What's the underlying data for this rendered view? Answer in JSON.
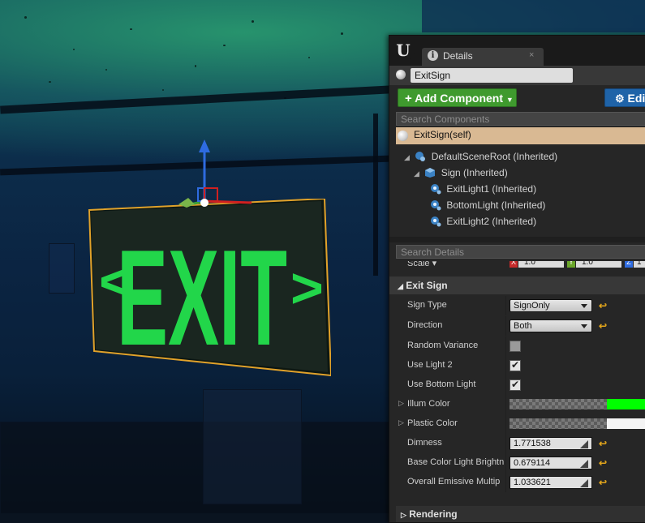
{
  "details": {
    "tab_label": "Details",
    "tab_close": "×",
    "actor_name": "ExitSign",
    "add_component": "Add Component",
    "edit_blueprint": "Edi",
    "search_components_placeholder": "Search Components",
    "self_item": "ExitSign(self)",
    "components": [
      {
        "label": "DefaultSceneRoot (Inherited)"
      },
      {
        "label": "Sign (Inherited)"
      },
      {
        "label": "ExitLight1 (Inherited)"
      },
      {
        "label": "BottomLight (Inherited)"
      },
      {
        "label": "ExitLight2 (Inherited)"
      }
    ],
    "search_details_placeholder": "Search Details",
    "scale": {
      "label": "Scale",
      "x": "1.0",
      "y": "1.0",
      "z_axis": "Z",
      "x_axis": "X",
      "y_axis": "Y"
    },
    "section_title": "Exit Sign",
    "props": {
      "sign_type": {
        "label": "Sign Type",
        "value": "SignOnly"
      },
      "direction": {
        "label": "Direction",
        "value": "Both"
      },
      "random_variance": {
        "label": "Random Variance",
        "checked": false
      },
      "use_light_2": {
        "label": "Use Light 2",
        "checked": true
      },
      "use_bottom_light": {
        "label": "Use Bottom Light",
        "checked": true
      },
      "illum_color": {
        "label": "Illum Color",
        "color": "#00ff00"
      },
      "plastic_color": {
        "label": "Plastic Color",
        "color": "#f4f4f4"
      },
      "dimness": {
        "label": "Dimness",
        "value": "1.771538"
      },
      "base_color_light_brightness": {
        "label": "Base Color Light Brightn",
        "value": "0.679114"
      },
      "overall_emissive": {
        "label": "Overall Emissive Multip",
        "value": "1.033621"
      }
    },
    "rendering_label": "Rendering"
  },
  "viewport": {
    "sign_text": "EXIT",
    "sign_left_chevron": "<",
    "sign_right_chevron": ">",
    "sign_color": "#22d64a"
  },
  "colors": {
    "add_button": "#3f9a2e",
    "edit_button": "#1f63a8",
    "selection": "#d9b993",
    "reset_icon": "#e2a51b"
  }
}
